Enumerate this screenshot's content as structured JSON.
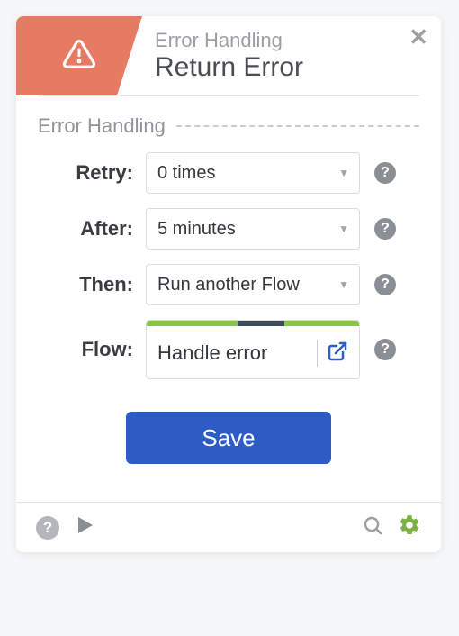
{
  "header": {
    "subtitle": "Error Handling",
    "title": "Return Error"
  },
  "section": {
    "label": "Error Handling"
  },
  "fields": {
    "retry": {
      "label": "Retry:",
      "value": "0 times"
    },
    "after": {
      "label": "After:",
      "value": "5 minutes"
    },
    "then": {
      "label": "Then:",
      "value": "Run another Flow"
    },
    "flow": {
      "label": "Flow:",
      "value": "Handle error"
    }
  },
  "buttons": {
    "save": "Save"
  }
}
